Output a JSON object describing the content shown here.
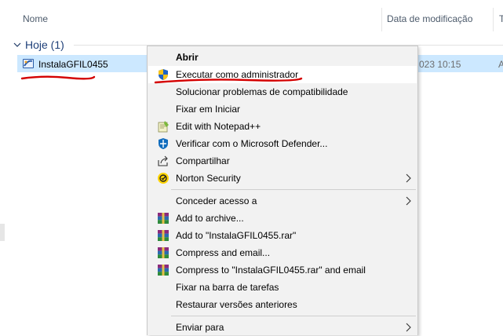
{
  "columns": {
    "name": "Nome",
    "date": "Data de modificação",
    "type": "T"
  },
  "group": {
    "title": "Hoje (1)"
  },
  "file": {
    "name": "InstalaGFIL0455",
    "date": "023 10:15",
    "type": "A"
  },
  "menu": {
    "items": [
      {
        "label": "Abrir",
        "icon": "none",
        "bold": true
      },
      {
        "label": "Executar como administrador",
        "icon": "uac-shield-icon",
        "highlighted": true
      },
      {
        "label": "Solucionar problemas de compatibilidade",
        "icon": "none"
      },
      {
        "label": "Fixar em Iniciar",
        "icon": "none"
      },
      {
        "label": "Edit with Notepad++",
        "icon": "notepadpp-icon"
      },
      {
        "label": "Verificar com o Microsoft Defender...",
        "icon": "defender-icon"
      },
      {
        "label": "Compartilhar",
        "icon": "share-icon"
      },
      {
        "label": "Norton Security",
        "icon": "norton-icon",
        "submenu": true
      },
      {
        "label": "Conceder acesso a",
        "icon": "none",
        "submenu": true
      },
      {
        "label": "Add to archive...",
        "icon": "winrar-icon"
      },
      {
        "label": "Add to \"InstalaGFIL0455.rar\"",
        "icon": "winrar-icon"
      },
      {
        "label": "Compress and email...",
        "icon": "winrar-icon"
      },
      {
        "label": "Compress to \"InstalaGFIL0455.rar\" and email",
        "icon": "winrar-icon"
      },
      {
        "label": "Fixar na barra de tarefas",
        "icon": "none"
      },
      {
        "label": "Restaurar versões anteriores",
        "icon": "none"
      },
      {
        "label": "Enviar para",
        "icon": "none",
        "submenu": true
      }
    ]
  },
  "colors": {
    "selection": "#cce8ff",
    "menu_bg": "#f2f2f2",
    "annotation": "#d40000"
  }
}
